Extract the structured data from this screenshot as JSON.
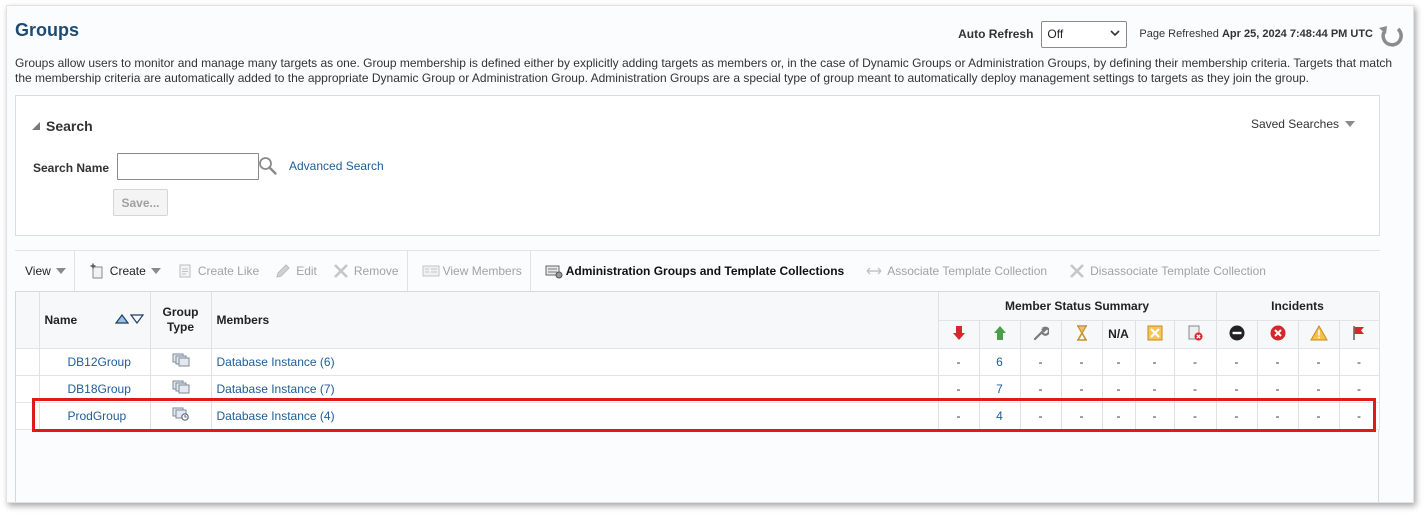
{
  "header": {
    "title": "Groups",
    "auto_refresh_label": "Auto Refresh",
    "auto_refresh_value": "Off",
    "page_refreshed_label": "Page Refreshed",
    "page_refreshed_value": "Apr 25, 2024 7:48:44 PM UTC"
  },
  "description": "Groups allow users to monitor and manage many targets as one. Group membership is defined either by explicitly adding targets as members or, in the case of Dynamic Groups or Administration Groups, by defining their membership criteria. Targets that match the membership criteria are automatically added to the appropriate Dynamic Group or Administration Group. Administration Groups are a special type of group meant to automatically deploy management settings to targets as they join the group.",
  "search": {
    "title": "Search",
    "saved_searches": "Saved Searches",
    "search_name_label": "Search Name",
    "search_name_value": "",
    "advanced_search": "Advanced Search",
    "save_label": "Save..."
  },
  "toolbar": {
    "view": "View",
    "create": "Create",
    "create_like": "Create Like",
    "edit": "Edit",
    "remove": "Remove",
    "view_members": "View Members",
    "admin_groups": "Administration Groups and Template Collections",
    "associate": "Associate Template Collection",
    "disassociate": "Disassociate Template Collection"
  },
  "table": {
    "headers": {
      "name": "Name",
      "group_type_1": "Group",
      "group_type_2": "Type",
      "members": "Members",
      "member_status_summary": "Member Status Summary",
      "incidents": "Incidents",
      "na": "N/A"
    },
    "rows": [
      {
        "name": "DB12Group",
        "members": "Database Instance (6)",
        "status": [
          "-",
          "6",
          "-",
          "-",
          "-",
          "-",
          "-"
        ],
        "incidents": [
          "-",
          "-",
          "-",
          "-"
        ]
      },
      {
        "name": "DB18Group",
        "members": "Database Instance (7)",
        "status": [
          "-",
          "7",
          "-",
          "-",
          "-",
          "-",
          "-"
        ],
        "incidents": [
          "-",
          "-",
          "-",
          "-"
        ]
      },
      {
        "name": "ProdGroup",
        "members": "Database Instance (4)",
        "status": [
          "-",
          "4",
          "-",
          "-",
          "-",
          "-",
          "-"
        ],
        "incidents": [
          "-",
          "-",
          "-",
          "-"
        ]
      }
    ]
  },
  "colors": {
    "title": "#1d4b73",
    "link": "#1f5c99",
    "highlight": "#e01a1a",
    "status_down": "#d9262c",
    "status_up": "#4aa04a"
  }
}
